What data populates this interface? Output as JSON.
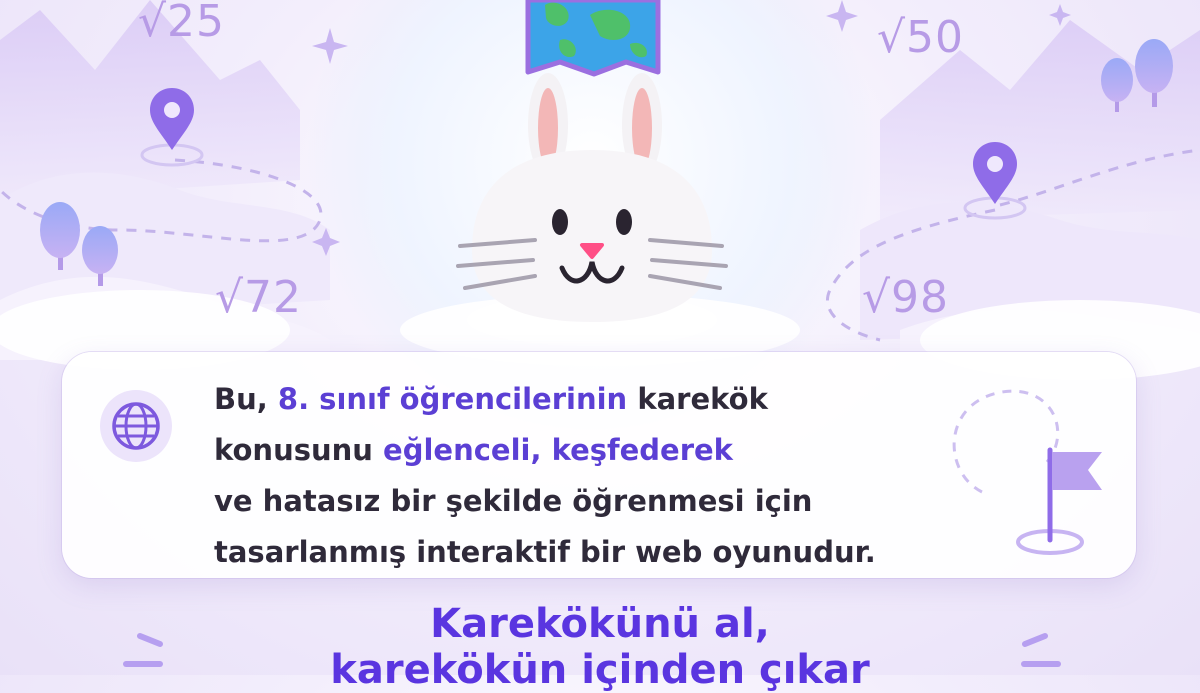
{
  "math_labels": [
    "√25",
    "√50",
    "√72",
    "√98"
  ],
  "card": {
    "line1_a": "Bu,",
    "line1_hl": "8. sınıf öğrencilerinin",
    "line1_b": "karekök",
    "line2_a": "konusunu",
    "line2_hl": "eğlenceli, keşfederek",
    "line3": "ve hatasız bir şekilde öğrenmesi için",
    "line4": "tasarlanmış interaktif bir web oyunudur."
  },
  "headline": {
    "line1": "Karekökünü al,",
    "line2": "karekökün içinden çıkar"
  },
  "colors": {
    "accent": "#5a35e0",
    "highlight": "#5b3fd4",
    "math": "#b79be6",
    "pin": "#8f6ce8",
    "nose": "#ff4f86"
  },
  "icons": [
    "globe-icon",
    "location-pin-icon",
    "flag-icon",
    "map-icon",
    "bunny-mascot",
    "tree-icon",
    "sparkle-icon"
  ]
}
